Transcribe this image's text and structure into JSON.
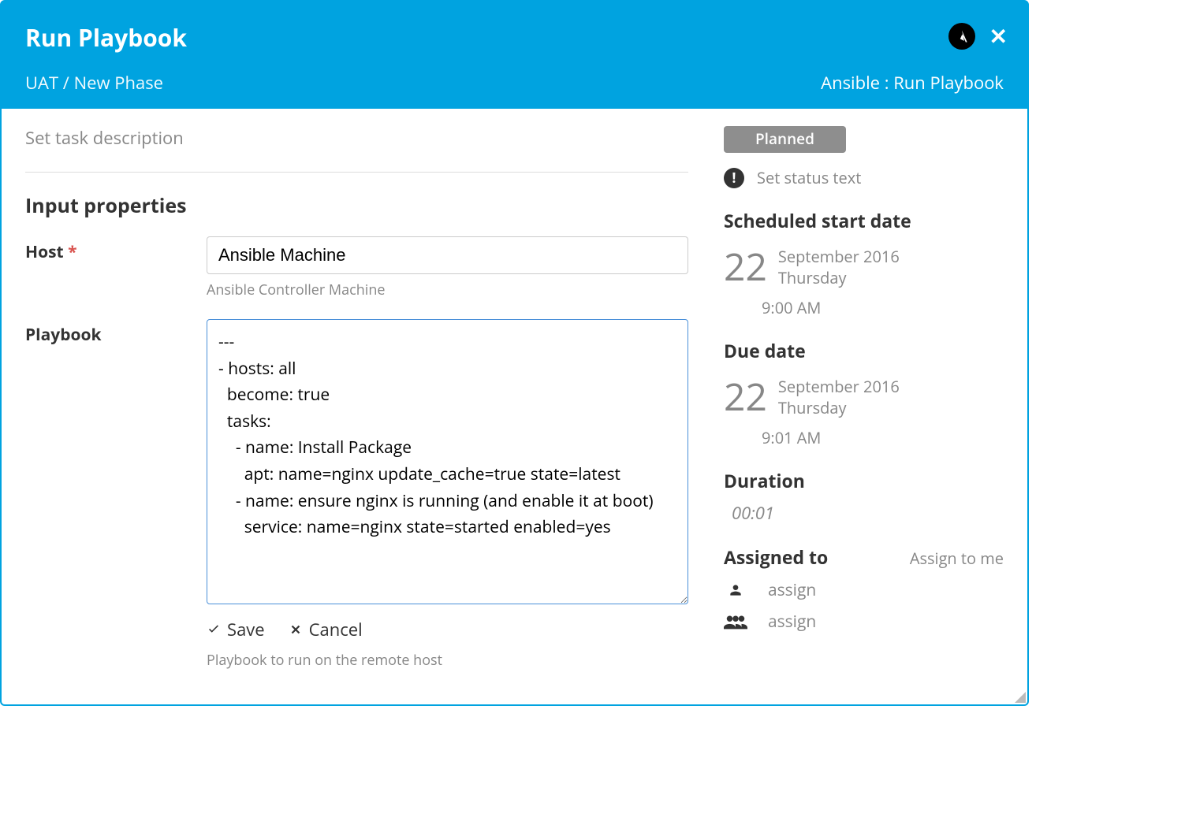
{
  "header": {
    "title": "Run Playbook",
    "breadcrumb": "UAT / New Phase",
    "pluginLabel": "Ansible : Run Playbook"
  },
  "description": {
    "placeholder": "Set task description"
  },
  "inputProperties": {
    "sectionTitle": "Input properties",
    "host": {
      "label": "Host",
      "value": "Ansible Machine",
      "hint": "Ansible Controller Machine"
    },
    "playbook": {
      "label": "Playbook",
      "value": "---\n- hosts: all\n  become: true\n  tasks:\n    - name: Install Package\n      apt: name=nginx update_cache=true state=latest\n    - name: ensure nginx is running (and enable it at boot)\n      service: name=nginx state=started enabled=yes",
      "hint": "Playbook to run on the remote host"
    },
    "actions": {
      "save": "Save",
      "cancel": "Cancel"
    }
  },
  "sidebar": {
    "status": "Planned",
    "statusTextPlaceholder": "Set status text",
    "scheduledStart": {
      "label": "Scheduled start date",
      "day": "22",
      "monthYear": "September 2016",
      "weekday": "Thursday",
      "time": "9:00 AM"
    },
    "dueDate": {
      "label": "Due date",
      "day": "22",
      "monthYear": "September 2016",
      "weekday": "Thursday",
      "time": "9:01 AM"
    },
    "duration": {
      "label": "Duration",
      "value": "00:01"
    },
    "assigned": {
      "label": "Assigned to",
      "assignToMe": "Assign to me",
      "userPlaceholder": "assign",
      "groupPlaceholder": "assign"
    }
  }
}
